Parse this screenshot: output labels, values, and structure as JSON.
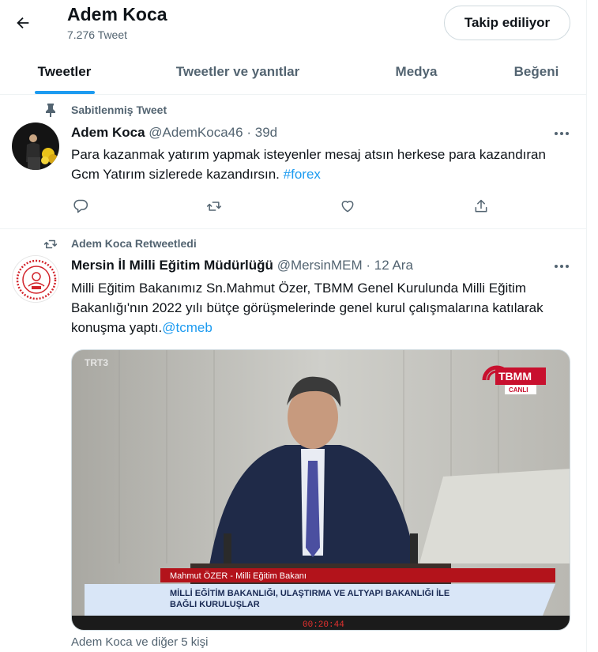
{
  "header": {
    "title": "Adem Koca",
    "tweet_count": "7.276 Tweet",
    "follow_label": "Takip ediliyor"
  },
  "tabs": [
    {
      "label": "Tweetler",
      "active": true
    },
    {
      "label": "Tweetler ve yanıtlar",
      "active": false
    },
    {
      "label": "Medya",
      "active": false
    },
    {
      "label": "Beğeni",
      "active": false
    }
  ],
  "pinned_tweet": {
    "context": "Sabitlenmiş Tweet",
    "name": "Adem Koca",
    "handle": "@AdemKoca46",
    "separator": "·",
    "time": "39d",
    "text": "Para kazanmak yatırım yapmak isteyenler mesaj atsın herkese para kazandıran Gcm Yatırım sizlerede kazandırsın.",
    "hashtag": "#forex"
  },
  "retweet": {
    "context": "Adem Koca Retweetledi",
    "name": "Mersin İl Milli Eğitim Müdürlüğü",
    "handle": "@MersinMEM",
    "separator": "·",
    "time": "12 Ara",
    "text": "Milli Eğitim Bakanımız Sn.Mahmut Özer, TBMM Genel Kurulunda Milli Eğitim Bakanlığı'nın 2022 yılı bütçe görüşmelerinde genel kurul çalışmalarına katılarak konuşma yaptı.",
    "mention": "@tcmeb",
    "media": {
      "channel_logo": "TRT3",
      "tbmm_logo": "TBMM",
      "tbmm_sub": "CANLI",
      "lower_third_name": "Mahmut ÖZER - Milli Eğitim Bakanı",
      "lower_third_caption_1": "MİLLİ EĞİTİM BAKANLIĞI, ULAŞTIRMA VE ALTYAPI BAKANLIĞI İLE",
      "lower_third_caption_2": "BAĞLI KURULUŞLAR",
      "clock": "00:20:44"
    },
    "footer": "Adem Koca ve diğer 5 kişi"
  },
  "icons": {
    "back": "back-arrow-icon",
    "pin": "pin-icon",
    "retweet_context": "retweet-icon",
    "more": "more-icon",
    "reply": "reply-icon",
    "retweet": "retweet-icon",
    "like": "heart-icon",
    "share": "share-icon"
  },
  "colors": {
    "accent": "#1d9bf0",
    "secondary_text": "#536471",
    "tbmm_red": "#c8102e"
  }
}
